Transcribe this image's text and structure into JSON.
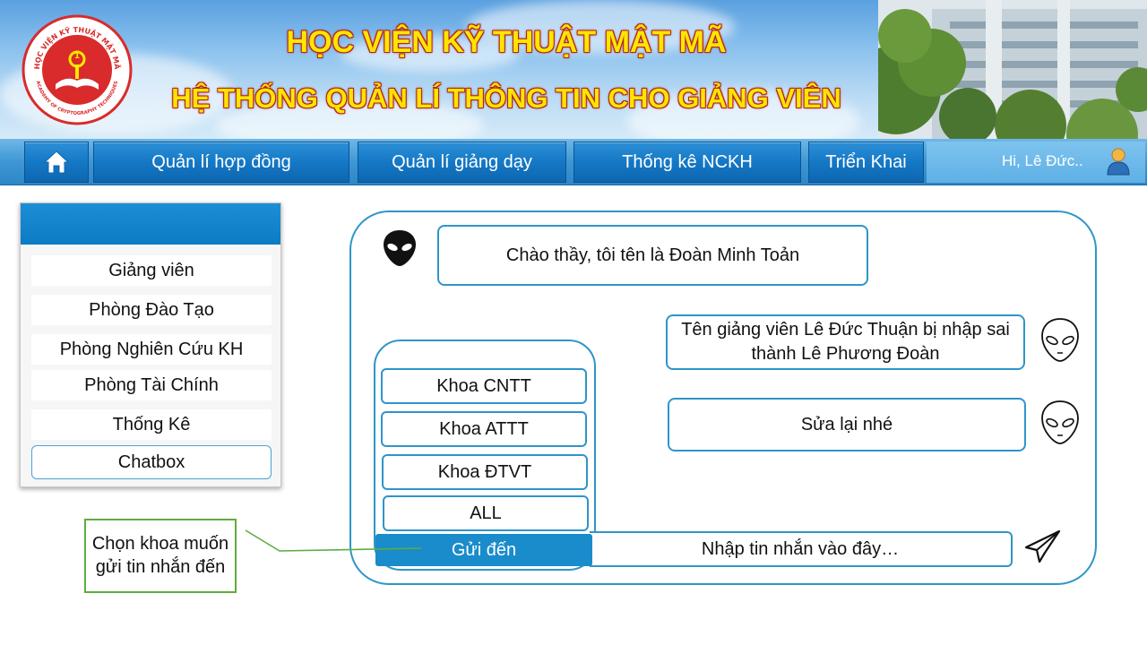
{
  "banner": {
    "title_line1": "HỌC VIỆN KỸ THUẬT MẬT MÃ",
    "title_line2": "HỆ THỐNG QUẢN LÍ THÔNG TIN CHO GIẢNG VIÊN",
    "logo_text_top": "HỌC VIỆN KỸ THUẬT MẬT MÃ",
    "logo_text_bottom": "ACADEMY OF CRYPTOGRAPHY TECHNIQUES",
    "title_color": "#ffe600",
    "title_outline_color": "#b3261e"
  },
  "nav": {
    "home_icon": "home-icon",
    "items": [
      {
        "label": "Quản lí hợp đồng"
      },
      {
        "label": "Quản lí giảng dạy"
      },
      {
        "label": "Thống kê NCKH"
      },
      {
        "label": "Triển Khai"
      }
    ],
    "greeting": "Hi, Lê Đức..",
    "user_icon": "user-icon"
  },
  "sidebar": {
    "items": [
      {
        "label": "Giảng viên"
      },
      {
        "label": "Phòng Đào Tạo"
      },
      {
        "label": "Phòng Nghiên Cứu KH"
      },
      {
        "label": "Phòng Tài Chính"
      },
      {
        "label": "Thống Kê"
      },
      {
        "label": "Chatbox",
        "active": true
      }
    ]
  },
  "chat": {
    "messages": [
      {
        "sender": "incoming",
        "text": "Chào thầy, tôi tên là Đoàn Minh Toản"
      },
      {
        "sender": "outgoing",
        "text": "Tên giảng viên Lê Đức Thuận bị nhập sai thành Lê Phương Đoàn"
      },
      {
        "sender": "outgoing",
        "text": "Sửa lại nhé"
      }
    ],
    "departments": [
      "Khoa CNTT",
      "Khoa ATTT",
      "Khoa ĐTVT",
      "ALL"
    ],
    "send_to_label": "Gửi đến",
    "input_text": "Nhập tin nhắn vào đây…",
    "send_icon": "send-icon",
    "accent_color": "#2f95c8"
  },
  "annotation": {
    "text": "Chọn khoa muốn gửi tin nhắn đến",
    "border_color": "#5cad3e"
  }
}
